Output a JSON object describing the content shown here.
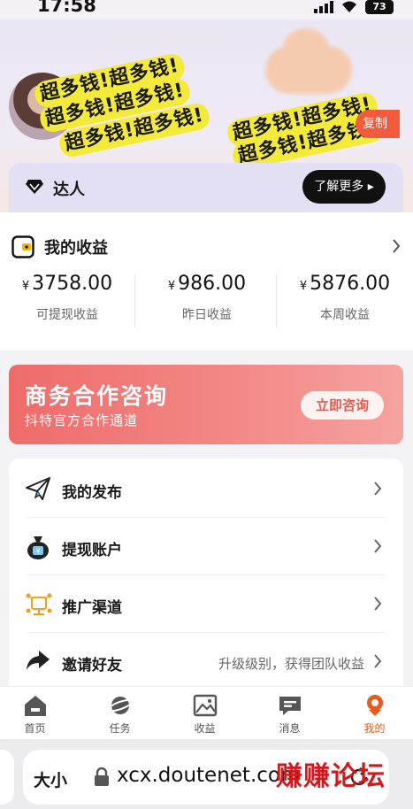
{
  "status_bar": {
    "time": "17:58",
    "battery": "73"
  },
  "header": {
    "watermark_text": "超多钱!超多钱!",
    "copy_label": "复制",
    "vip_label": "达人",
    "learn_more_label": "了解更多 ▸"
  },
  "earnings": {
    "title": "我的收益",
    "currency": "¥",
    "columns": [
      {
        "value": "3758.00",
        "label": "可提现收益"
      },
      {
        "value": "986.00",
        "label": "昨日收益"
      },
      {
        "value": "5876.00",
        "label": "本周收益"
      }
    ]
  },
  "banner": {
    "title": "商务合作咨询",
    "subtitle": "抖特官方合作通道",
    "button": "立即咨询"
  },
  "menu": {
    "items": [
      {
        "label": "我的发布",
        "icon": "paper-plane-icon",
        "hint": ""
      },
      {
        "label": "提现账户",
        "icon": "money-bag-icon",
        "hint": ""
      },
      {
        "label": "推广渠道",
        "icon": "network-icon",
        "hint": ""
      },
      {
        "label": "邀请好友",
        "icon": "share-arrow-icon",
        "hint": "升级级别，获得团队收益"
      }
    ]
  },
  "tabbar": {
    "tabs": [
      {
        "label": "首页",
        "icon": "home-icon",
        "active": false
      },
      {
        "label": "任务",
        "icon": "planet-icon",
        "active": false
      },
      {
        "label": "收益",
        "icon": "image-chart-icon",
        "active": false
      },
      {
        "label": "消息",
        "icon": "message-icon",
        "active": false
      },
      {
        "label": "我的",
        "icon": "profile-icon",
        "active": true
      }
    ]
  },
  "browser": {
    "text_size": "大小",
    "url": "xcx.doutenet.com"
  },
  "overlay": {
    "forum_mark": "赚赚论坛"
  },
  "colors": {
    "accent": "#e85a1a",
    "copy_button": "#f25b3b",
    "banner": "#ee6c6a",
    "watermark": "#f3ea3a"
  }
}
